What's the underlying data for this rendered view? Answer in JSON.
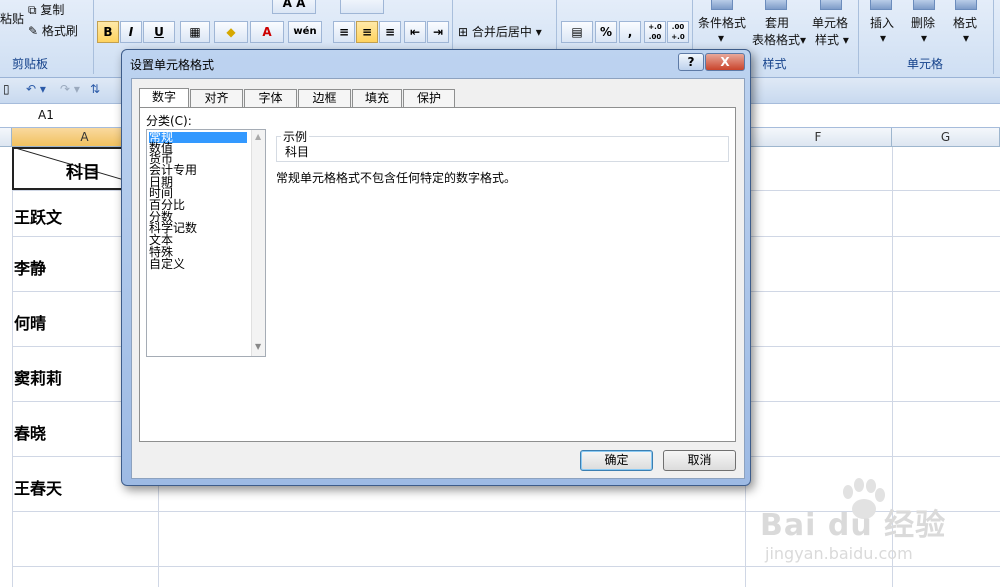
{
  "ribbon": {
    "clipboard": {
      "paste": "粘贴",
      "copy": "复制",
      "format_painter": "格式刷",
      "group_label": "剪贴板"
    },
    "font": {
      "bold": "B",
      "italic": "I",
      "underline": "U",
      "font_color": "A",
      "phonetic": "wén"
    },
    "alignment": {
      "merge_center": "合并后居中"
    },
    "number": {
      "percent": "%",
      "comma": ",",
      "inc_decimal": "+.0 .00",
      "dec_decimal": ".00 +.0"
    },
    "styles": {
      "conditional": "条件格式",
      "table_format_1": "套用",
      "table_format_2": "表格格式",
      "cell_styles_1": "单元格",
      "cell_styles_2": "样式",
      "group_label": "样式"
    },
    "cells": {
      "insert": "插入",
      "delete": "删除",
      "format": "格式",
      "group_label": "单元格"
    }
  },
  "formula_bar": {
    "name_box": "A1"
  },
  "grid": {
    "columns": [
      "A",
      "F",
      "G"
    ],
    "header_cell": "科目",
    "names": [
      "王跃文",
      "李静",
      "何晴",
      "窦莉莉",
      "春晓",
      "王春天"
    ]
  },
  "dialog": {
    "title": "设置单元格格式",
    "help": "?",
    "close": "X",
    "tabs": [
      "数字",
      "对齐",
      "字体",
      "边框",
      "填充",
      "保护"
    ],
    "category_label": "分类(C):",
    "categories": [
      "常规",
      "数值",
      "货币",
      "会计专用",
      "日期",
      "时间",
      "百分比",
      "分数",
      "科学记数",
      "文本",
      "特殊",
      "自定义"
    ],
    "sample_label": "示例",
    "sample_value": "科目",
    "description": "常规单元格格式不包含任何特定的数字格式。",
    "ok": "确定",
    "cancel": "取消"
  },
  "watermark": {
    "brand": "Bai du 经验",
    "url": "jingyan.baidu.com"
  }
}
